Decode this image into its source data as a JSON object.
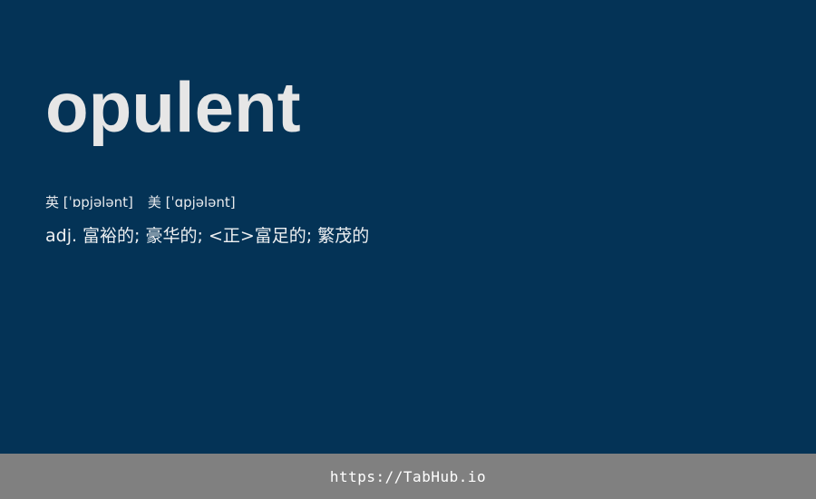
{
  "entry": {
    "word": "opulent",
    "phonetic_uk": "英 [ˈɒpjələnt]",
    "phonetic_us": "美 [ˈɑpjələnt]",
    "definition": "adj. 富裕的; 豪华的; <正>富足的; 繁茂的"
  },
  "footer": {
    "link": "https://TabHub.io"
  },
  "colors": {
    "background": "#043356",
    "footer_background": "#808080",
    "word": "#e6e6e6",
    "text": "#eef0f2"
  }
}
